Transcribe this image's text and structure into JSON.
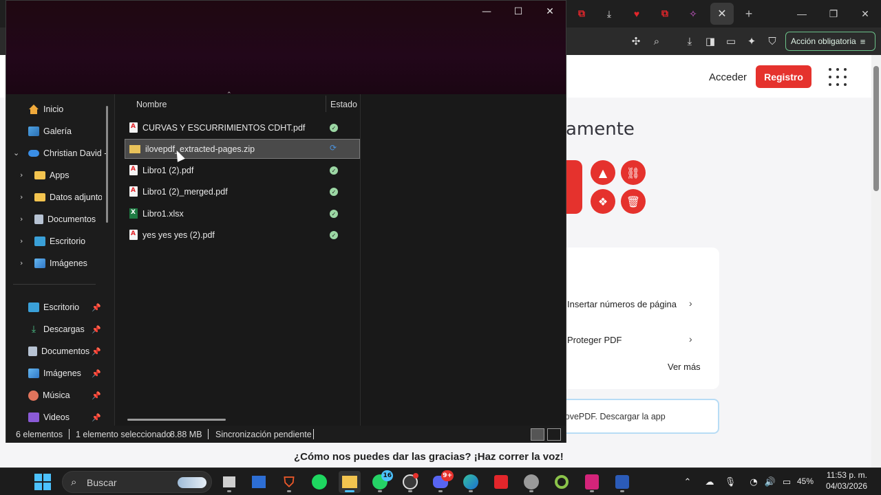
{
  "browser": {
    "action_required_label": "Acción obligatoria",
    "tab_close_symbol": "✕",
    "new_tab_symbol": "+"
  },
  "webpage": {
    "login_label": "Acceder",
    "register_label": "Registro",
    "hero_title_partial": "amente",
    "tools": [
      {
        "label": "Insertar números de página"
      },
      {
        "label": "Proteger PDF"
      }
    ],
    "see_more_label": "Ver más",
    "app_banner_brand": "lovePDF.",
    "app_banner_link": "Descargar la app",
    "thanks_text": "¿Cómo nos puedes dar las gracias? ¡Haz correr la voz!"
  },
  "explorer": {
    "nav": [
      {
        "label": "Inicio",
        "icon": "home-icon"
      },
      {
        "label": "Galería",
        "icon": "gallery-icon"
      },
      {
        "label": "Christian David -",
        "icon": "onedrive-icon"
      },
      {
        "label": "Apps",
        "icon": "folder-icon"
      },
      {
        "label": "Datos adjuntos",
        "icon": "folder-icon"
      },
      {
        "label": "Documentos",
        "icon": "documents-icon"
      },
      {
        "label": "Escritorio",
        "icon": "desktop-icon"
      },
      {
        "label": "Imágenes",
        "icon": "images-icon"
      }
    ],
    "quick_access": [
      {
        "label": "Escritorio",
        "icon": "desktop-icon"
      },
      {
        "label": "Descargas",
        "icon": "download-icon"
      },
      {
        "label": "Documentos",
        "icon": "documents-icon"
      },
      {
        "label": "Imágenes",
        "icon": "images-icon"
      },
      {
        "label": "Música",
        "icon": "music-icon"
      },
      {
        "label": "Videos",
        "icon": "video-icon"
      }
    ],
    "columns": {
      "name": "Nombre",
      "status": "Estado"
    },
    "files": [
      {
        "name": "CURVAS Y ESCURRIMIENTOS CDHT.pdf",
        "type": "pdf",
        "status": "synced"
      },
      {
        "name": "ilovepdf_extracted-pages.zip",
        "type": "zip",
        "status": "syncing",
        "selected": true
      },
      {
        "name": "Libro1 (2).pdf",
        "type": "pdf",
        "status": "synced"
      },
      {
        "name": "Libro1 (2)_merged.pdf",
        "type": "pdf",
        "status": "synced"
      },
      {
        "name": "Libro1.xlsx",
        "type": "xlsx",
        "status": "synced"
      },
      {
        "name": "yes yes yes  (2).pdf",
        "type": "pdf",
        "status": "synced"
      }
    ],
    "status_bar": {
      "item_count": "6 elementos",
      "selection": "1 elemento seleccionado",
      "size": "8.88 MB",
      "sync": "Sincronización pendiente"
    }
  },
  "taskbar": {
    "search_label": "Buscar",
    "whatsapp_badge": "16",
    "discord_badge": "9+",
    "battery_percent": "45%",
    "time": "11:53 p. m.",
    "date": "04/03/2026"
  },
  "colors": {
    "brand_red": "#e5322d",
    "titlebar": "#22071a",
    "accent": "#4cc2ff"
  }
}
